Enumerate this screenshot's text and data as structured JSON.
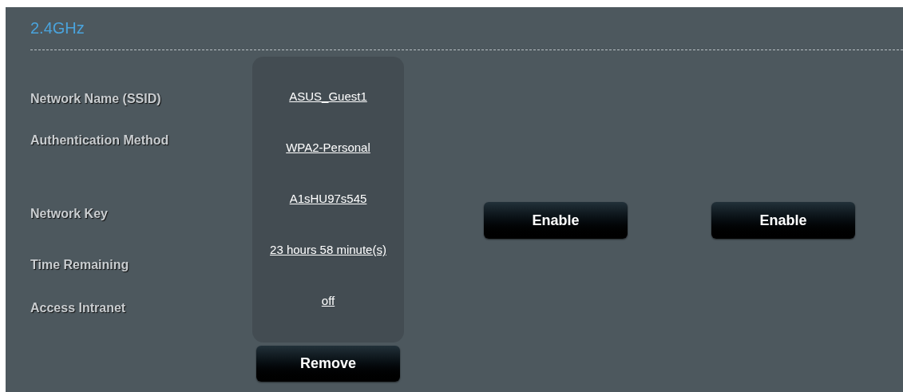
{
  "band": {
    "title": "2.4GHz"
  },
  "guest": {
    "rows": [
      {
        "label": "Network Name (SSID)",
        "value": "ASUS_Guest1"
      },
      {
        "label": "Authentication Method",
        "value": "WPA2-Personal"
      },
      {
        "label": "Network Key",
        "value": "A1sHU97s545"
      },
      {
        "label": "Time Remaining",
        "value": "23 hours 58 minute(s)"
      },
      {
        "label": "Access Intranet",
        "value": "off"
      }
    ],
    "remove_button": "Remove"
  },
  "enable_buttons": [
    "Enable",
    "Enable"
  ]
}
